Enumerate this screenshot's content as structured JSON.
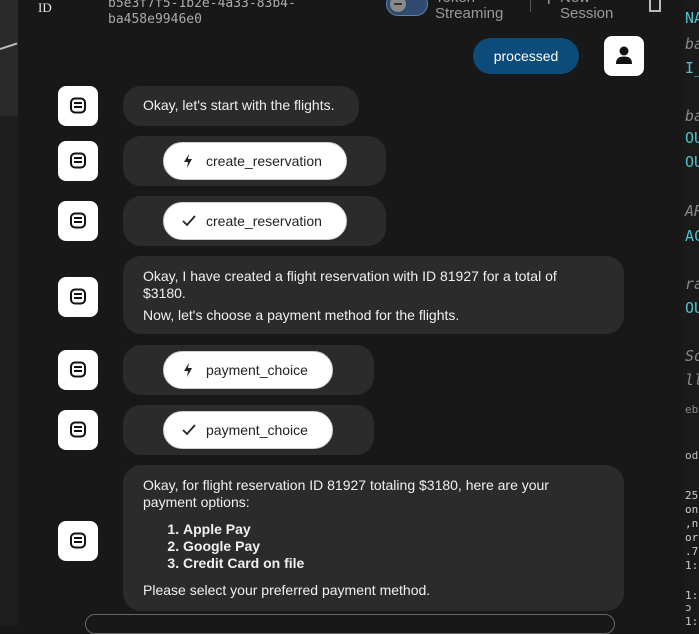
{
  "header": {
    "id_label": "ID",
    "session_id_line1": "b5e3f7f5-1b2e-4a33-83b4-",
    "session_id_line2": "ba458e9946e0",
    "token_streaming_label": "Token\nStreaming",
    "new_session_label": "New\nSession"
  },
  "user_message": {
    "status_label": "processed"
  },
  "messages": [
    {
      "text": "Okay, let's start with the flights."
    },
    {
      "tool": "create_reservation",
      "state": "calling"
    },
    {
      "tool": "create_reservation",
      "state": "done"
    },
    {
      "line1": "Okay, I have created a flight reservation with ID 81927 for a total of",
      "line2": "$3180.",
      "line3": "Now, let's choose a payment method for the flights."
    },
    {
      "tool": "payment_choice",
      "state": "calling"
    },
    {
      "tool": "payment_choice",
      "state": "done"
    },
    {
      "intro_line1": "Okay, for flight reservation ID 81927 totaling $3180, here are your",
      "intro_line2": "payment options:",
      "options": [
        "Apple Pay",
        "Google Pay",
        "Credit Card on file"
      ],
      "outro": "Please select your preferred payment method."
    }
  ],
  "code_pane": {
    "lines": [
      "NA",
      "ba",
      "I_",
      "ba",
      "OU",
      "OU",
      "AR",
      "AC",
      "ra",
      "OU",
      "So",
      "ll",
      "ebu",
      "oda",
      "25,",
      "on",
      ",nP",
      "or\"",
      ".72",
      "1:",
      "1:",
      "ɔ C",
      "1:"
    ]
  },
  "colors": {
    "background": "#181818",
    "bubble": "#2b2b2b",
    "accent": "#0d4b7a"
  },
  "icons": {
    "bot": "robot-icon",
    "user": "user-icon",
    "tool_calling": "lightning-icon",
    "tool_done": "check-icon",
    "delete": "trash-icon",
    "add": "plus-icon"
  }
}
